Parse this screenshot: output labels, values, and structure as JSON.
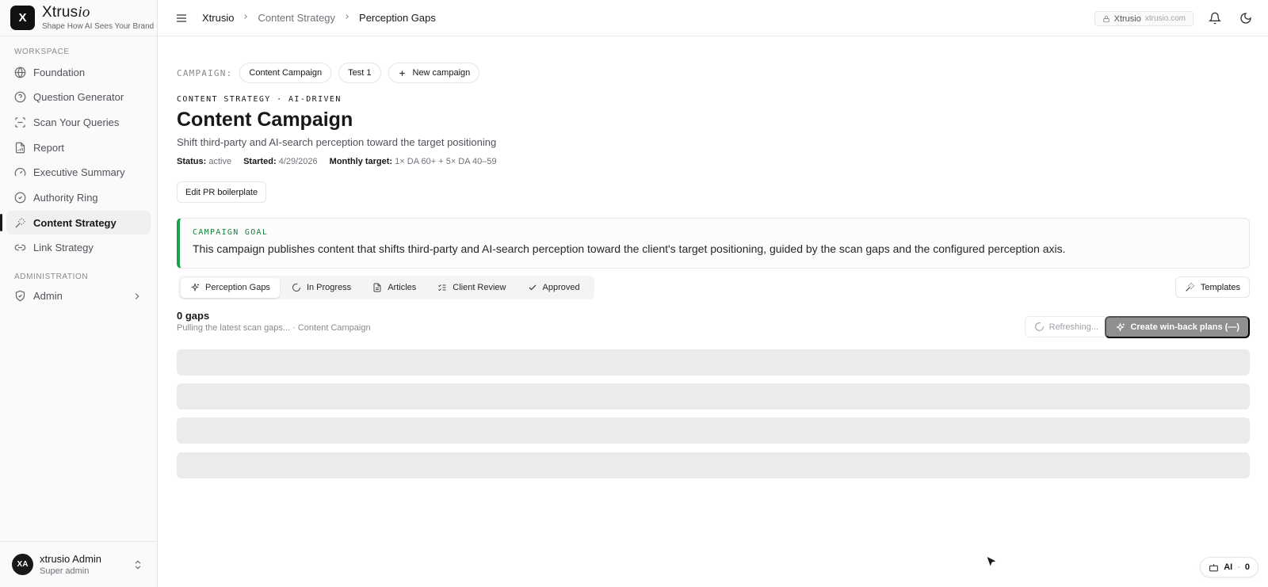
{
  "brand": {
    "name_main": "Xtrus",
    "name_italic": "io",
    "tagline": "Shape How AI Sees Your Brand",
    "logo_letter": "X"
  },
  "sidebar": {
    "workspace_label": "WORKSPACE",
    "items": [
      {
        "label": "Foundation",
        "icon": "globe-icon"
      },
      {
        "label": "Question Generator",
        "icon": "help-circle-icon"
      },
      {
        "label": "Scan Your Queries",
        "icon": "scan-icon"
      },
      {
        "label": "Report",
        "icon": "file-chart-icon"
      },
      {
        "label": "Executive Summary",
        "icon": "gauge-icon"
      },
      {
        "label": "Authority Ring",
        "icon": "check-circle-icon"
      },
      {
        "label": "Content Strategy",
        "icon": "magic-wand-icon",
        "active": true
      },
      {
        "label": "Link Strategy",
        "icon": "link-icon"
      }
    ],
    "admin_label": "ADMINISTRATION",
    "admin_item": {
      "label": "Admin",
      "icon": "shield-check-icon"
    }
  },
  "user": {
    "initials": "XA",
    "name": "xtrusio Admin",
    "role": "Super admin"
  },
  "topbar": {
    "breadcrumbs": [
      "Xtrusio",
      "Content Strategy",
      "Perception Gaps"
    ],
    "domain_chip": {
      "label": "Xtrusio",
      "domain": "xtrusio.com"
    }
  },
  "campaign": {
    "label": "CAMPAIGN:",
    "pills": [
      "Content Campaign",
      "Test 1"
    ],
    "new_label": "New campaign",
    "eyebrow": "CONTENT STRATEGY · AI-DRIVEN",
    "title": "Content Campaign",
    "subtitle": "Shift third-party and AI-search perception toward the target positioning",
    "meta": {
      "status_key": "Status:",
      "status_val": "active",
      "started_key": "Started:",
      "started_val": "4/29/2026",
      "target_key": "Monthly target:",
      "target_val": "1× DA 60+ + 5× DA 40–59"
    },
    "edit_label": "Edit PR boilerplate",
    "goal_label": "CAMPAIGN GOAL",
    "goal_text": "This campaign publishes content that shifts third-party and AI-search perception toward the client's target positioning, guided by the scan gaps and the configured perception axis."
  },
  "tabs": [
    {
      "label": "Perception Gaps",
      "icon": "sparkles-icon",
      "active": true
    },
    {
      "label": "In Progress",
      "icon": "loader-icon"
    },
    {
      "label": "Articles",
      "icon": "file-text-icon"
    },
    {
      "label": "Client Review",
      "icon": "list-checks-icon"
    },
    {
      "label": "Approved",
      "icon": "check-icon"
    }
  ],
  "templates_label": "Templates",
  "gaps": {
    "count": "0 gaps",
    "status": "Pulling the latest scan gaps... · Content Campaign",
    "refresh_label": "Refreshing...",
    "winback_label": "Create win-back plans (—)"
  },
  "ai_chip": {
    "label": "AI",
    "sep": "·",
    "count": "0"
  },
  "colors": {
    "accent_green": "#16a34a",
    "primary_dark": "#18181b",
    "skeleton": "#ebebeb",
    "disabled_button": "#8f8f8f"
  }
}
